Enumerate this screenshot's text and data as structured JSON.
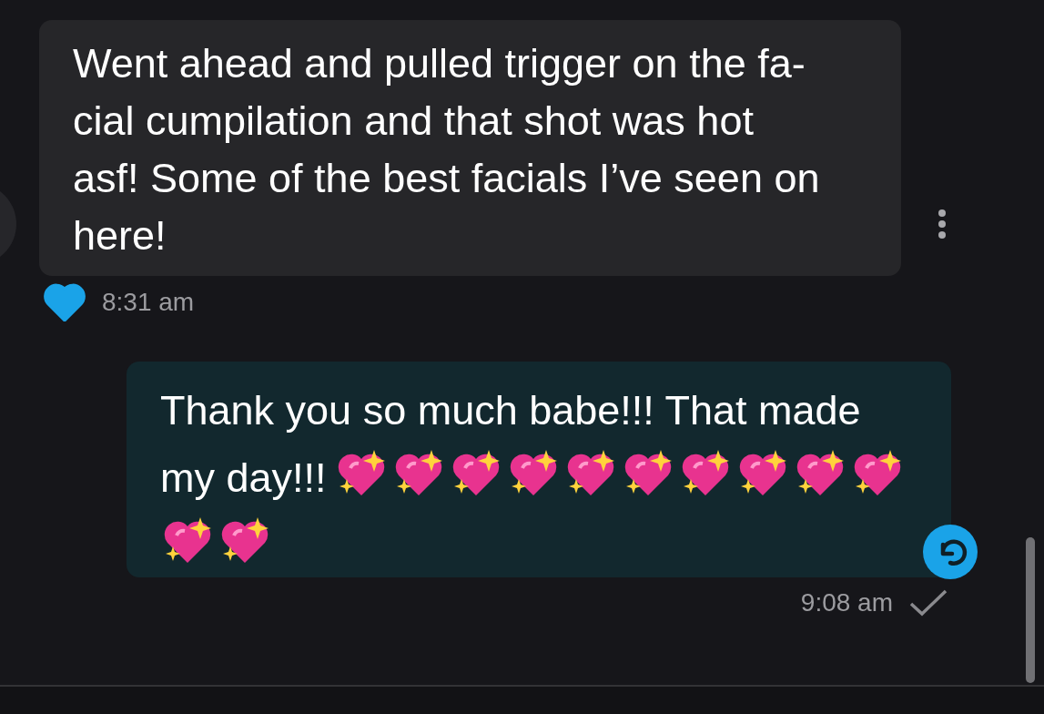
{
  "messages": [
    {
      "kind": "received",
      "text": "Went ahead and pulled trigger on the fa-\ncial cumpilation and that shot was hot\nasf! Some of the best facials I’ve seen on\nhere!",
      "liked": true,
      "time": "8:31 am"
    },
    {
      "kind": "sent",
      "text": "Thank you so much babe!!! That made\nmy day!!!",
      "emojis": [
        {
          "kind": "sparkling-heart"
        },
        {
          "kind": "sparkling-heart"
        },
        {
          "kind": "sparkling-heart"
        },
        {
          "kind": "sparkling-heart"
        },
        {
          "kind": "sparkling-heart"
        },
        {
          "kind": "sparkling-heart"
        },
        {
          "kind": "sparkling-heart"
        },
        {
          "kind": "sparkling-heart"
        },
        {
          "kind": "sparkling-heart"
        },
        {
          "kind": "sparkling-heart"
        },
        {
          "kind": "sparkling-heart"
        },
        {
          "kind": "sparkling-heart"
        }
      ],
      "time": "9:08 am",
      "delivered": true
    }
  ]
}
